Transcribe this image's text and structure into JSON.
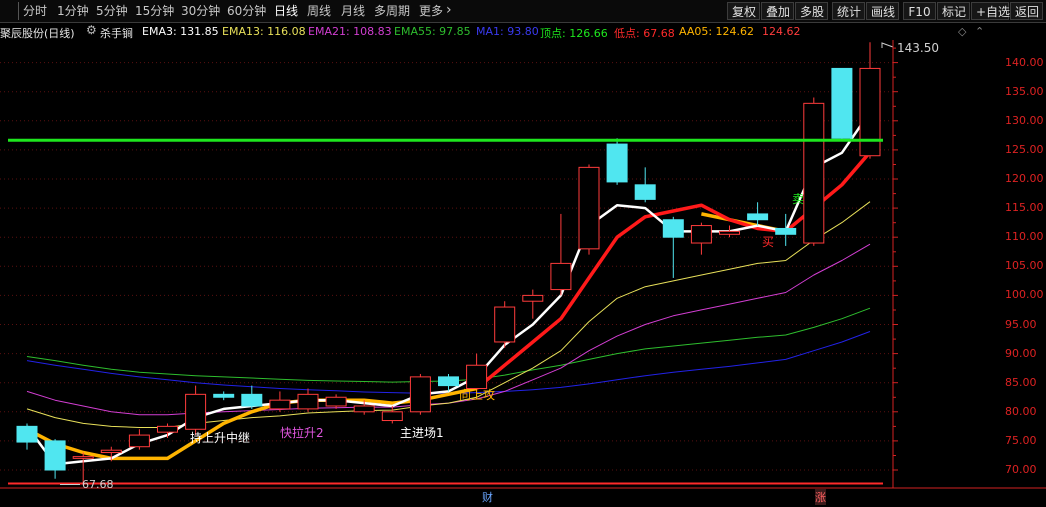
{
  "toolbar": {
    "timeframes": [
      "分时",
      "1分钟",
      "5分钟",
      "15分钟",
      "30分钟",
      "60分钟",
      "日线",
      "周线",
      "月线",
      "多周期",
      "更多"
    ],
    "active_timeframe": "日线",
    "more_arrow": "›",
    "buttons": [
      "复权",
      "叠加",
      "多股",
      "统计",
      "画线",
      "F10",
      "标记",
      "+自选",
      "返回"
    ]
  },
  "info": {
    "stock_title": "聚辰股份(日线)",
    "indicator_name": "杀手锏",
    "ema3": "EMA3: 131.85",
    "ema13": "EMA13: 116.08",
    "ema21": "EMA21: 108.83",
    "ema55": "EMA55: 97.85",
    "ma1": "MA1: 93.80",
    "top": "顶点: 126.66",
    "bottom": "低点: 67.68",
    "aa05": "AA05: 124.62",
    "aa05b": "124.62"
  },
  "colors": {
    "ema3": "#ffffff",
    "ema13": "#e8e05a",
    "ema21": "#d23ed2",
    "ema55": "#2ebd2e",
    "ma1": "#2222e6",
    "top": "#1ee61e",
    "bottom": "#ff2a2a",
    "aa05": "#ffb400",
    "up": "#ff3c3c",
    "down": "#50e6f0",
    "axis": "#d22222"
  },
  "annotations": {
    "high_value": "143.50",
    "low_value": "67.68",
    "rise_relay": "持上升中继",
    "pull_up": "快拉升2",
    "enter": "主进场1",
    "break_up": "向上攻",
    "sell": "卖",
    "buy": "买",
    "finance": "财",
    "rise": "涨"
  },
  "chart_data": {
    "type": "candlestick",
    "yticks": [
      70,
      75,
      80,
      85,
      90,
      95,
      100,
      105,
      110,
      115,
      120,
      125,
      130,
      135,
      140
    ],
    "ylim": [
      67,
      145
    ],
    "top_line": 126.66,
    "bottom_line": 67.68,
    "candles": [
      {
        "o": 77.5,
        "c": 74.8,
        "h": 78.0,
        "l": 73.5
      },
      {
        "o": 75.0,
        "c": 70.0,
        "h": 75.3,
        "l": 68.5
      },
      {
        "o": 72.0,
        "c": 72.3,
        "h": 73.0,
        "l": 67.7
      },
      {
        "o": 73.0,
        "c": 73.4,
        "h": 74.0,
        "l": 71.5
      },
      {
        "o": 74.0,
        "c": 76.0,
        "h": 77.0,
        "l": 73.5
      },
      {
        "o": 76.5,
        "c": 77.5,
        "h": 78.0,
        "l": 75.5
      },
      {
        "o": 77.0,
        "c": 83.0,
        "h": 84.5,
        "l": 76.0
      },
      {
        "o": 83.0,
        "c": 82.5,
        "h": 83.5,
        "l": 82.0
      },
      {
        "o": 83.0,
        "c": 81.0,
        "h": 84.5,
        "l": 80.5
      },
      {
        "o": 80.5,
        "c": 82.0,
        "h": 83.5,
        "l": 80.0
      },
      {
        "o": 80.5,
        "c": 83.0,
        "h": 84.0,
        "l": 80.0
      },
      {
        "o": 81.0,
        "c": 82.5,
        "h": 83.0,
        "l": 80.5
      },
      {
        "o": 80.0,
        "c": 81.0,
        "h": 82.0,
        "l": 79.5
      },
      {
        "o": 78.5,
        "c": 80.0,
        "h": 81.0,
        "l": 78.0
      },
      {
        "o": 80.0,
        "c": 86.0,
        "h": 86.5,
        "l": 79.5
      },
      {
        "o": 86.0,
        "c": 84.5,
        "h": 86.5,
        "l": 83.5
      },
      {
        "o": 84.0,
        "c": 88.0,
        "h": 90.0,
        "l": 83.5
      },
      {
        "o": 92.0,
        "c": 98.0,
        "h": 99.0,
        "l": 91.0
      },
      {
        "o": 99.0,
        "c": 100.0,
        "h": 101.0,
        "l": 96.0
      },
      {
        "o": 101.0,
        "c": 105.5,
        "h": 114.0,
        "l": 100.0
      },
      {
        "o": 108.0,
        "c": 122.0,
        "h": 122.5,
        "l": 107.0
      },
      {
        "o": 126.0,
        "c": 119.5,
        "h": 127.0,
        "l": 119.0
      },
      {
        "o": 119.0,
        "c": 116.5,
        "h": 122.0,
        "l": 116.0
      },
      {
        "o": 113.0,
        "c": 110.0,
        "h": 113.5,
        "l": 103.0
      },
      {
        "o": 109.0,
        "c": 112.0,
        "h": 112.5,
        "l": 107.0
      },
      {
        "o": 110.5,
        "c": 111.0,
        "h": 112.0,
        "l": 110.0
      },
      {
        "o": 114.0,
        "c": 113.0,
        "h": 116.0,
        "l": 112.0
      },
      {
        "o": 111.5,
        "c": 110.5,
        "h": 114.0,
        "l": 108.5
      },
      {
        "o": 109.0,
        "c": 133.0,
        "h": 134.0,
        "l": 108.5
      },
      {
        "o": 139.0,
        "c": 127.0,
        "h": 139.0,
        "l": 126.5
      },
      {
        "o": 124.0,
        "c": 139.0,
        "h": 143.5,
        "l": 123.5
      }
    ],
    "ema3": [
      77.5,
      71.0,
      71.5,
      72.0,
      74.5,
      76.0,
      79.0,
      80.5,
      81.0,
      81.5,
      82.0,
      82.0,
      81.5,
      81.0,
      83.0,
      83.5,
      86.0,
      91.5,
      95.0,
      100.0,
      112.0,
      115.5,
      115.0,
      111.0,
      111.0,
      111.0,
      112.0,
      111.0,
      122.0,
      124.5,
      131.5
    ],
    "aa05": [
      77.0,
      74.5,
      73.0,
      72.0,
      72.0,
      72.0,
      75.0,
      78.0,
      80.0,
      81.5,
      82.0,
      82.0,
      82.0,
      81.5,
      82.0,
      83.0,
      84.0,
      null,
      null,
      null,
      null,
      null,
      null,
      null,
      114.0,
      113.0,
      112.0,
      111.0,
      null,
      null,
      null
    ],
    "red_line": [
      null,
      null,
      null,
      null,
      null,
      null,
      null,
      null,
      null,
      null,
      null,
      null,
      null,
      null,
      null,
      null,
      84.0,
      88.0,
      92.0,
      96.0,
      103.0,
      110.0,
      113.5,
      114.5,
      115.5,
      113.0,
      111.5,
      111.0,
      115.0,
      119.0,
      124.6
    ],
    "ema13": [
      80.5,
      79.0,
      78.0,
      77.5,
      77.3,
      77.3,
      78.0,
      78.5,
      79.0,
      79.3,
      79.8,
      80.0,
      80.2,
      80.3,
      81.0,
      81.5,
      82.5,
      85.0,
      87.5,
      90.5,
      95.5,
      99.5,
      101.5,
      102.5,
      103.5,
      104.5,
      105.5,
      106.0,
      109.5,
      112.5,
      116.1
    ],
    "ema21": [
      83.5,
      82.0,
      81.0,
      80.0,
      79.5,
      79.5,
      79.8,
      80.0,
      80.2,
      80.4,
      80.6,
      80.7,
      80.8,
      80.8,
      81.2,
      81.5,
      82.2,
      83.5,
      85.5,
      87.5,
      90.5,
      93.0,
      95.0,
      96.5,
      97.5,
      98.5,
      99.5,
      100.5,
      103.5,
      106.0,
      108.8
    ],
    "ema55": [
      89.5,
      88.8,
      88.0,
      87.3,
      86.8,
      86.5,
      86.2,
      86.0,
      85.8,
      85.6,
      85.4,
      85.3,
      85.2,
      85.1,
      85.2,
      85.3,
      85.6,
      86.3,
      87.2,
      88.0,
      89.0,
      90.0,
      90.8,
      91.3,
      91.8,
      92.3,
      92.8,
      93.2,
      94.5,
      96.0,
      97.8
    ],
    "ma1": [
      88.8,
      88.0,
      87.3,
      86.6,
      86.0,
      85.5,
      85.0,
      84.6,
      84.3,
      84.0,
      83.8,
      83.6,
      83.4,
      83.3,
      83.2,
      83.2,
      83.3,
      83.5,
      83.8,
      84.2,
      84.8,
      85.5,
      86.2,
      86.8,
      87.3,
      87.8,
      88.4,
      89.0,
      90.5,
      92.0,
      93.8
    ]
  }
}
